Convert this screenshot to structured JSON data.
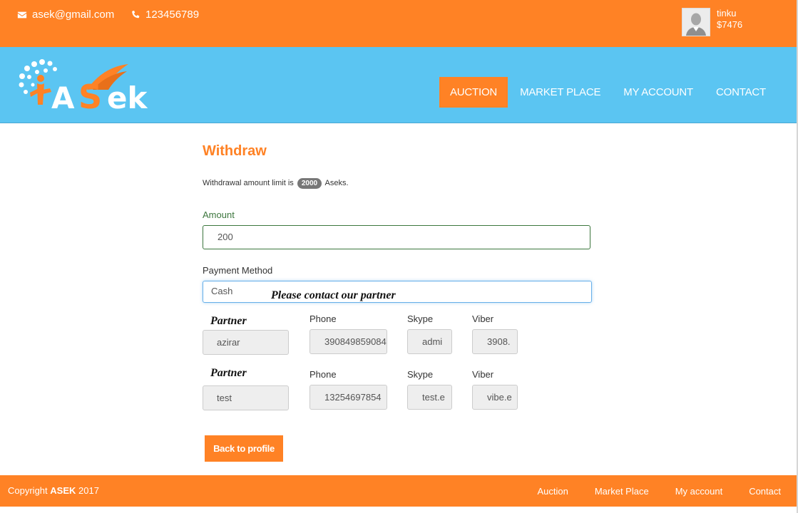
{
  "topbar": {
    "email": "asek@gmail.com",
    "phone": "123456789",
    "user_name": "tinku",
    "user_balance": "$7476"
  },
  "header": {
    "logo_text": "ASek",
    "nav": [
      {
        "label": "AUCTION",
        "active": true
      },
      {
        "label": "MARKET PLACE",
        "active": false
      },
      {
        "label": "MY ACCOUNT",
        "active": false
      },
      {
        "label": "CONTACT",
        "active": false
      }
    ]
  },
  "main": {
    "title": "Withdraw",
    "limit_prefix": "Withdrawal amount limit is",
    "limit_value": "2000",
    "limit_suffix": "Aseks.",
    "amount_label": "Amount",
    "amount_value": "200",
    "method_label": "Payment Method",
    "method_value": "Cash",
    "contact_note": "Please contact our partner",
    "partner_label": "Partner",
    "phone_label": "Phone",
    "skype_label": "Skype",
    "viber_label": "Viber",
    "partners": [
      {
        "name": "azirar",
        "phone": "390849859084",
        "skype": "admi",
        "viber": "3908."
      },
      {
        "name": "test",
        "phone": "13254697854",
        "skype": "test.e",
        "viber": "vibe.e"
      }
    ],
    "back_button": "Back to profile"
  },
  "footer": {
    "copyright_prefix": "Copyright",
    "copyright_brand": "ASEK",
    "copyright_year": "2017",
    "links": [
      "Auction",
      "Market Place",
      "My account",
      "Contact"
    ]
  },
  "colors": {
    "orange": "#ff8225",
    "sky": "#5bc5f2",
    "success_green": "#3c763d",
    "focus_blue": "#66afe9"
  }
}
